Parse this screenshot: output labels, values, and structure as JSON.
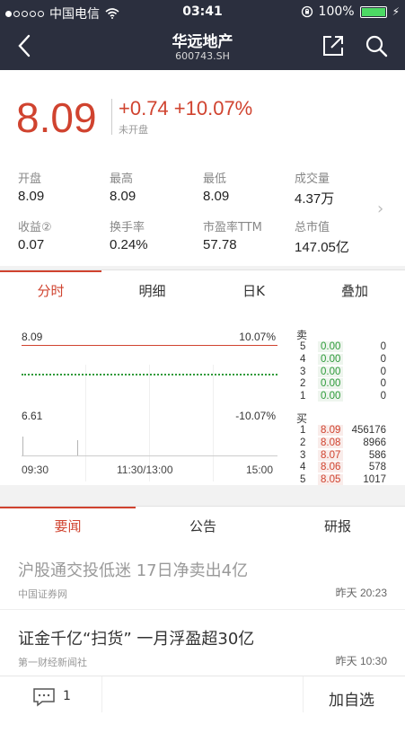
{
  "status": {
    "carrier": "中国电信",
    "time": "03:41",
    "battery": "100%",
    "signal_dots_filled": 1,
    "signal_dots_total": 5
  },
  "nav": {
    "title": "华远地产",
    "subtitle": "600743.SH",
    "icons": [
      "back-icon",
      "share-icon",
      "search-icon"
    ]
  },
  "quote": {
    "price": "8.09",
    "change": "+0.74 +10.07%",
    "trade_status": "未开盘",
    "stats": [
      {
        "label": "开盘",
        "value": "8.09"
      },
      {
        "label": "最高",
        "value": "8.09"
      },
      {
        "label": "最低",
        "value": "8.09"
      },
      {
        "label": "成交量",
        "value": "4.37万"
      },
      {
        "label": "收益②",
        "value": "0.07"
      },
      {
        "label": "换手率",
        "value": "0.24%"
      },
      {
        "label": "市盈率TTM",
        "value": "57.78"
      },
      {
        "label": "总市值",
        "value": "147.05亿"
      }
    ]
  },
  "chart_tabs": [
    "分时",
    "明细",
    "日K",
    "叠加"
  ],
  "chart": {
    "price_high": "8.09",
    "price_low": "6.61",
    "pct_high": "10.07%",
    "pct_low": "-10.07%",
    "times": [
      "09:30",
      "11:30/13:00",
      "15:00"
    ],
    "sell_label": "卖",
    "buy_label": "买",
    "sell": [
      {
        "n": "5",
        "price": "0.00",
        "vol": "0"
      },
      {
        "n": "4",
        "price": "0.00",
        "vol": "0"
      },
      {
        "n": "3",
        "price": "0.00",
        "vol": "0"
      },
      {
        "n": "2",
        "price": "0.00",
        "vol": "0"
      },
      {
        "n": "1",
        "price": "0.00",
        "vol": "0"
      }
    ],
    "buy": [
      {
        "n": "1",
        "price": "8.09",
        "vol": "456176"
      },
      {
        "n": "2",
        "price": "8.08",
        "vol": "8966"
      },
      {
        "n": "3",
        "price": "8.07",
        "vol": "586"
      },
      {
        "n": "4",
        "price": "8.06",
        "vol": "578"
      },
      {
        "n": "5",
        "price": "8.05",
        "vol": "1017"
      }
    ]
  },
  "news_tabs": [
    "要闻",
    "公告",
    "研报"
  ],
  "news": [
    {
      "title": "沪股通交投低迷 17日净卖出4亿",
      "source": "中国证券网",
      "time": "昨天 20:23"
    },
    {
      "title": "证金千亿“扫货” 一月浮盈超30亿",
      "source": "第一财经新闻社",
      "time": "昨天 10:30"
    }
  ],
  "bottom": {
    "comment_count": "1",
    "add_watch": "加自选"
  },
  "colors": {
    "up": "#d0432f",
    "down": "#2e9b3a",
    "header_bg": "#2b2f3e"
  }
}
